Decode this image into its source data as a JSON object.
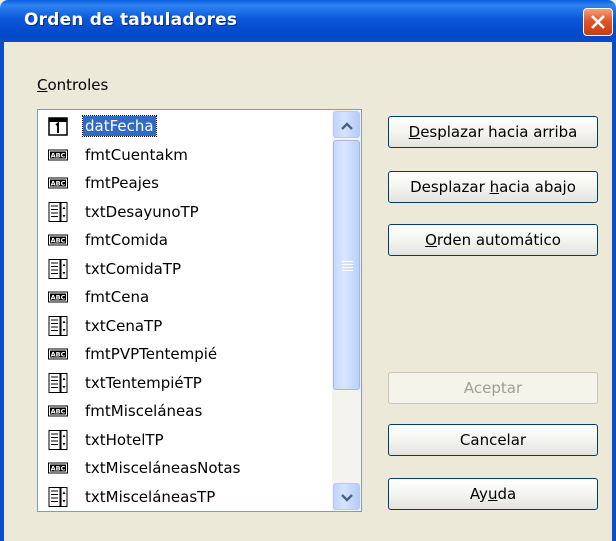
{
  "window": {
    "title": "Orden de tabuladores"
  },
  "group": {
    "label_mnemonic": "C",
    "label_rest": "ontroles"
  },
  "controls_list": {
    "items": [
      {
        "label": "datFecha",
        "icon": "date-field-icon",
        "selected": true
      },
      {
        "label": "fmtCuentakm",
        "icon": "formatted-field-icon"
      },
      {
        "label": "fmtPeajes",
        "icon": "formatted-field-icon"
      },
      {
        "label": "txtDesayunoTP",
        "icon": "spin-field-icon"
      },
      {
        "label": "fmtComida",
        "icon": "formatted-field-icon"
      },
      {
        "label": "txtComidaTP",
        "icon": "spin-field-icon"
      },
      {
        "label": "fmtCena",
        "icon": "formatted-field-icon"
      },
      {
        "label": "txtCenaTP",
        "icon": "spin-field-icon"
      },
      {
        "label": "fmtPVPTentempié",
        "icon": "formatted-field-icon"
      },
      {
        "label": "txtTentempiéTP",
        "icon": "spin-field-icon"
      },
      {
        "label": "fmtMisceláneas",
        "icon": "formatted-field-icon"
      },
      {
        "label": "txtHotelTP",
        "icon": "spin-field-icon"
      },
      {
        "label": "txtMisceláneasNotas",
        "icon": "formatted-field-icon"
      },
      {
        "label": "txtMisceláneasTP",
        "icon": "spin-field-icon"
      }
    ]
  },
  "buttons": {
    "move_up": {
      "pre": "",
      "mnemonic": "D",
      "post": "esplazar hacia arriba"
    },
    "move_down": {
      "pre": "Desplazar ",
      "mnemonic": "h",
      "post": "acia abajo"
    },
    "auto_order": {
      "pre": "",
      "mnemonic": "O",
      "post": "rden automático"
    },
    "ok": {
      "label": "Aceptar"
    },
    "cancel": {
      "label": "Cancelar"
    },
    "help": {
      "pre": "Ay",
      "mnemonic": "u",
      "post": "da"
    }
  },
  "colors": {
    "titlebar": "#0a58d8",
    "selection": "#316ac5",
    "close": "#e0562a"
  }
}
